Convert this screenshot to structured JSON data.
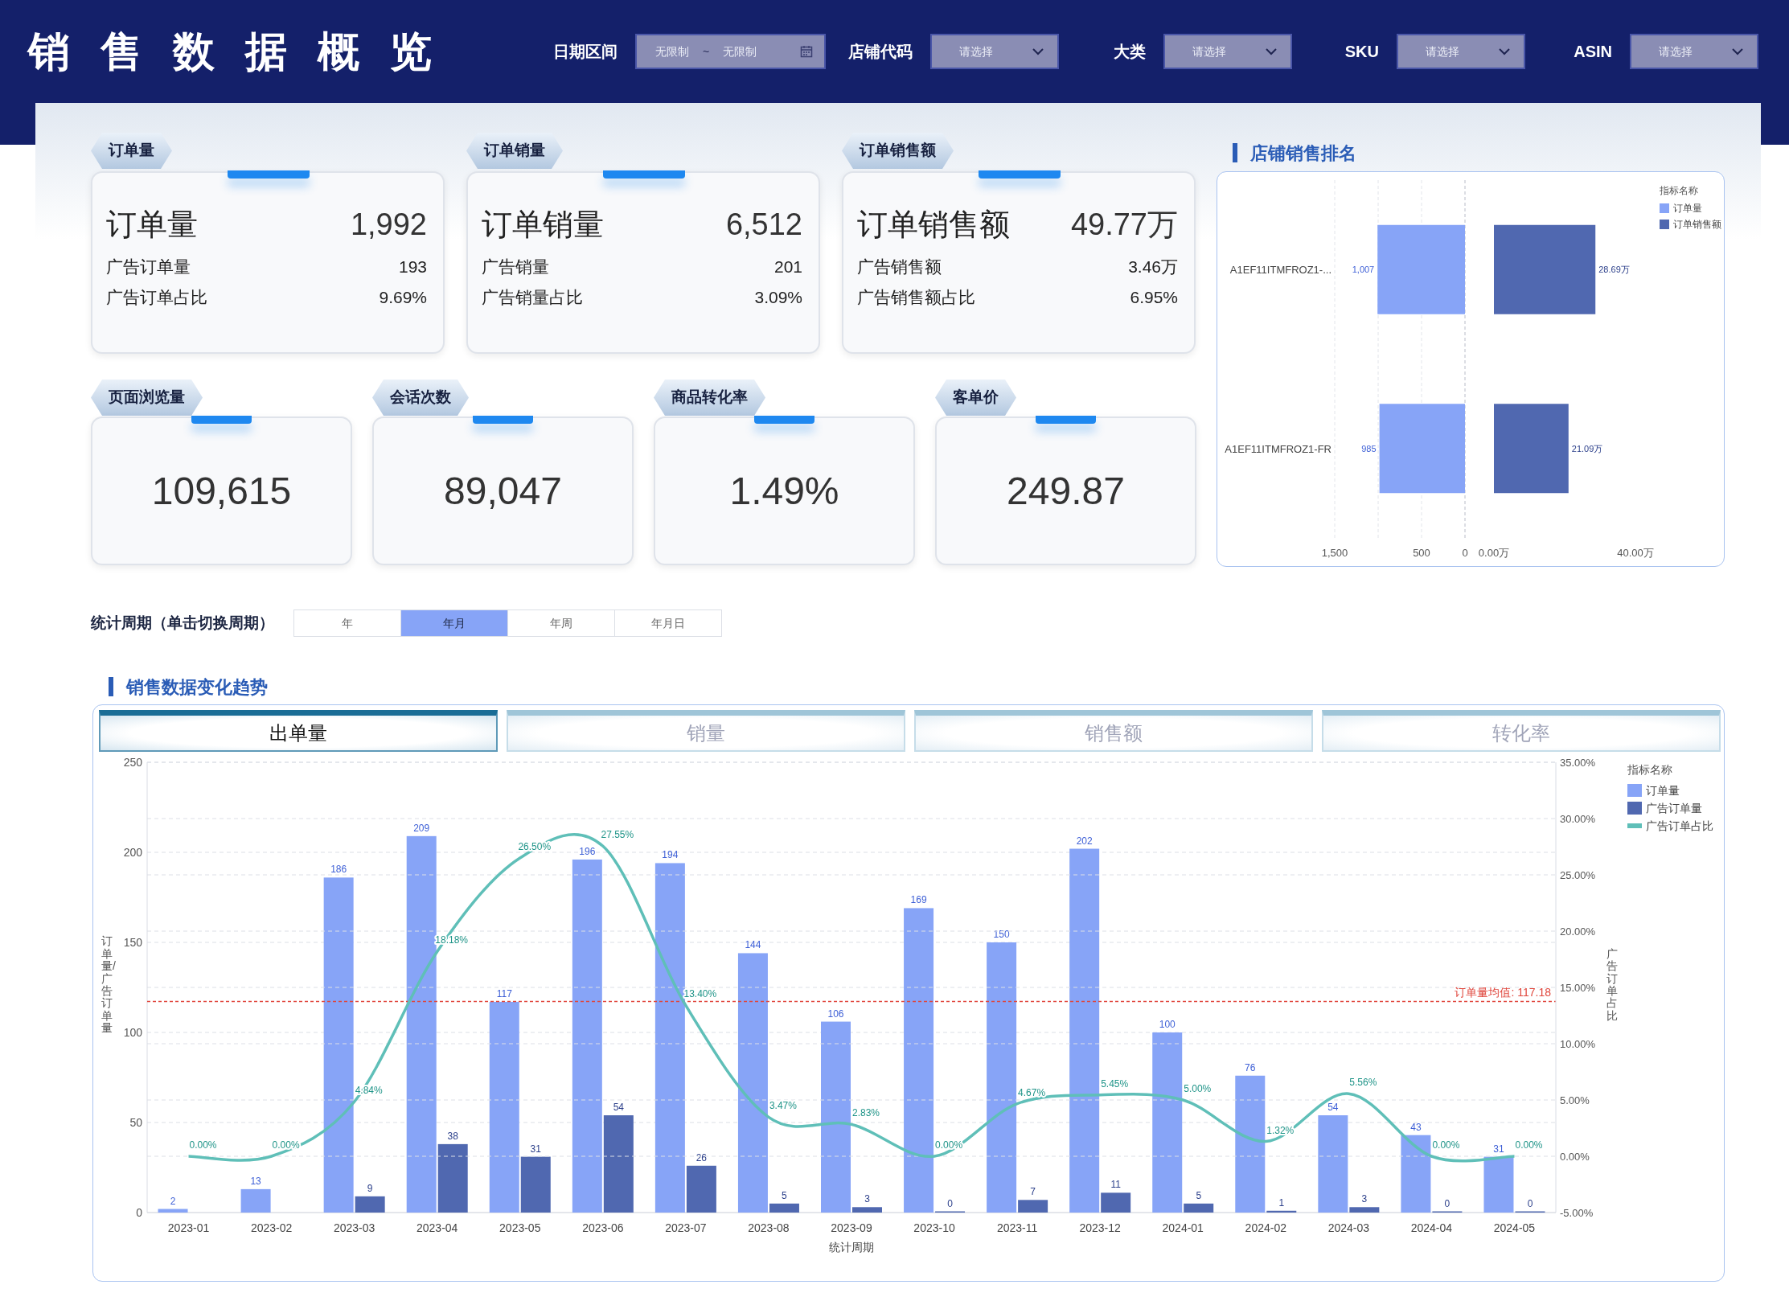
{
  "header": {
    "title": "销售数据概览",
    "filters": [
      {
        "kind": "date_range",
        "label": "日期区间",
        "start_placeholder": "无限制",
        "separator": "~",
        "end_placeholder": "无限制"
      },
      {
        "kind": "select",
        "label": "店铺代码",
        "placeholder": "请选择"
      },
      {
        "kind": "select",
        "label": "大类",
        "placeholder": "请选择"
      },
      {
        "kind": "select",
        "label": "SKU",
        "placeholder": "请选择"
      },
      {
        "kind": "select",
        "label": "ASIN",
        "placeholder": "请选择"
      }
    ]
  },
  "kpi_cards": [
    {
      "tag": "订单量",
      "title": "订单量",
      "value": "1,992",
      "rows": [
        {
          "label": "广告订单量",
          "value": "193"
        },
        {
          "label": "广告订单占比",
          "value": "9.69%"
        }
      ]
    },
    {
      "tag": "订单销量",
      "title": "订单销量",
      "value": "6,512",
      "rows": [
        {
          "label": "广告销量",
          "value": "201"
        },
        {
          "label": "广告销量占比",
          "value": "3.09%"
        }
      ]
    },
    {
      "tag": "订单销售额",
      "title": "订单销售额",
      "value": "49.77万",
      "rows": [
        {
          "label": "广告销售额",
          "value": "3.46万"
        },
        {
          "label": "广告销售额占比",
          "value": "6.95%"
        }
      ]
    }
  ],
  "metric_cards": [
    {
      "tag": "页面浏览量",
      "value": "109,615"
    },
    {
      "tag": "会话次数",
      "value": "89,047"
    },
    {
      "tag": "商品转化率",
      "value": "1.49%"
    },
    {
      "tag": "客单价",
      "value": "249.87"
    }
  ],
  "store_ranking": {
    "title": "店铺销售排名",
    "legend_title": "指标名称",
    "order_chart": {
      "chart_data": {
        "type": "bar",
        "orientation": "horizontal",
        "categories": [
          "A1EF11ITMFROZ1-...",
          "A1EF11ITMFROZ1-FR"
        ],
        "xlim": [
          1500,
          0
        ],
        "grid": true,
        "xticks": [
          {
            "value": 1500,
            "label": "1,500"
          },
          {
            "value": 500,
            "label": "500"
          },
          {
            "value": 0,
            "label": "0"
          }
        ],
        "series": [
          {
            "name": "订单量",
            "color": "#87a4f7",
            "values": [
              1007,
              985
            ],
            "value_labels": [
              "1,007",
              "985"
            ]
          }
        ]
      }
    },
    "sales_chart": {
      "chart_data": {
        "type": "bar",
        "orientation": "horizontal",
        "xlim": [
          0,
          40
        ],
        "xticks": [
          {
            "value": 0,
            "label": "0.00万"
          },
          {
            "value": 40,
            "label": "40.00万"
          }
        ],
        "series": [
          {
            "name": "订单销售额",
            "color": "#5068b0",
            "values": [
              28.69,
              21.09
            ],
            "value_labels": [
              "28.69万",
              "21.09万"
            ]
          }
        ]
      }
    }
  },
  "period": {
    "label": "统计周期（单击切换周期）",
    "options": [
      {
        "label": "年",
        "selected": false
      },
      {
        "label": "年月",
        "selected": true
      },
      {
        "label": "年周",
        "selected": false
      },
      {
        "label": "年月日",
        "selected": false
      }
    ]
  },
  "trend": {
    "title": "销售数据变化趋势",
    "legend_title": "指标名称",
    "tabs": [
      {
        "label": "出单量",
        "selected": true
      },
      {
        "label": "销量",
        "selected": false
      },
      {
        "label": "销售额",
        "selected": false
      },
      {
        "label": "转化率",
        "selected": false
      }
    ],
    "bar_chart": {
      "chart_data": {
        "type": "bar",
        "xlabel": "统计周期",
        "ylabel": "订单量/广告订单量",
        "grid": true,
        "categories": [
          "2023-01",
          "2023-02",
          "2023-03",
          "2023-04",
          "2023-05",
          "2023-06",
          "2023-07",
          "2023-08",
          "2023-09",
          "2023-10",
          "2023-11",
          "2023-12",
          "2024-01",
          "2024-02",
          "2024-03",
          "2024-04",
          "2024-05"
        ],
        "ylim": [
          0,
          250
        ],
        "yticks": [
          0,
          50,
          100,
          150,
          200,
          250
        ],
        "series": [
          {
            "name": "订单量",
            "color": "#87a4f7",
            "values": [
              2,
              13,
              186,
              209,
              117,
              196,
              194,
              144,
              106,
              169,
              150,
              202,
              100,
              76,
              54,
              43,
              31
            ],
            "value_labels": [
              "2",
              "13",
              "186",
              "209",
              "117",
              "196",
              "194",
              "144",
              "106",
              "169",
              "150",
              "202",
              "100",
              "76",
              "54",
              "43",
              "31"
            ]
          },
          {
            "name": "广告订单量",
            "color": "#5068b0",
            "values": [
              null,
              null,
              9,
              38,
              31,
              54,
              26,
              5,
              3,
              0,
              7,
              11,
              5,
              1,
              3,
              0,
              0
            ],
            "value_labels": [
              null,
              null,
              "9",
              "38",
              "31",
              "54",
              "26",
              "5",
              "3",
              "0",
              "7",
              "11",
              "5",
              "1",
              "3",
              "0",
              "0"
            ]
          }
        ],
        "ref_lines": [
          {
            "axis": "y",
            "value": 117.18,
            "label": "订单量均值: 117.18",
            "color": "#e0463c"
          }
        ]
      }
    },
    "ratio_chart": {
      "chart_data": {
        "type": "line",
        "ylabel": "广告订单占比",
        "grid": true,
        "ylim": [
          -5,
          35
        ],
        "yticks": [
          {
            "value": -5,
            "label": "-5.00%"
          },
          {
            "value": 0,
            "label": "0.00%"
          },
          {
            "value": 5,
            "label": "5.00%"
          },
          {
            "value": 10,
            "label": "10.00%"
          },
          {
            "value": 15,
            "label": "15.00%"
          },
          {
            "value": 20,
            "label": "20.00%"
          },
          {
            "value": 25,
            "label": "25.00%"
          },
          {
            "value": 30,
            "label": "30.00%"
          },
          {
            "value": 35,
            "label": "35.00%"
          }
        ],
        "series": [
          {
            "name": "广告订单占比",
            "color": "#5fbfb8",
            "values": [
              0,
              0,
              4.84,
              18.18,
              26.5,
              27.55,
              13.4,
              3.47,
              2.83,
              0,
              4.67,
              5.45,
              5.0,
              1.32,
              5.56,
              0,
              0
            ],
            "value_labels": [
              "0.00%",
              "0.00%",
              "4.84%",
              "18.18%",
              "26.50%",
              "27.55%",
              "13.40%",
              "3.47%",
              "2.83%",
              "0.00%",
              "4.67%",
              "5.45%",
              "5.00%",
              "1.32%",
              "5.56%",
              "0.00%",
              "0.00%"
            ]
          }
        ]
      }
    }
  }
}
